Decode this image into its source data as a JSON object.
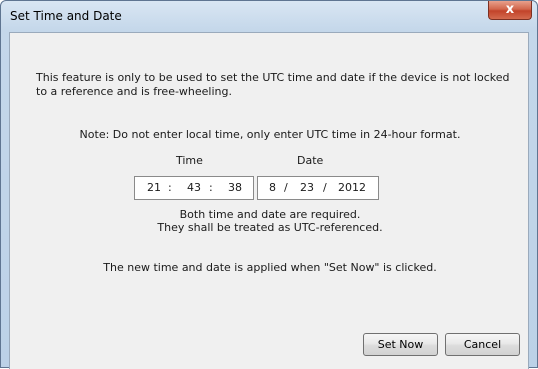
{
  "window": {
    "title": "Set Time and Date",
    "close_glyph": "x"
  },
  "dialog": {
    "description": "This feature is only to be used to set the UTC time and date if the device is not locked to a reference and is free-wheeling.",
    "note": "Note: Do not enter local time, only enter UTC time in 24-hour format.",
    "time_label": "Time",
    "date_label": "Date",
    "time": {
      "hours": "21",
      "minutes": "43",
      "seconds": "38",
      "separator": ":"
    },
    "date": {
      "month": "8",
      "day": "23",
      "year": "2012",
      "separator": "/"
    },
    "required_line1": "Both time and date are required.",
    "required_line2": "They shall be treated as UTC-referenced.",
    "applied_text": "The new time and date is applied when \"Set Now\" is clicked."
  },
  "buttons": {
    "set_now": "Set Now",
    "cancel": "Cancel"
  }
}
